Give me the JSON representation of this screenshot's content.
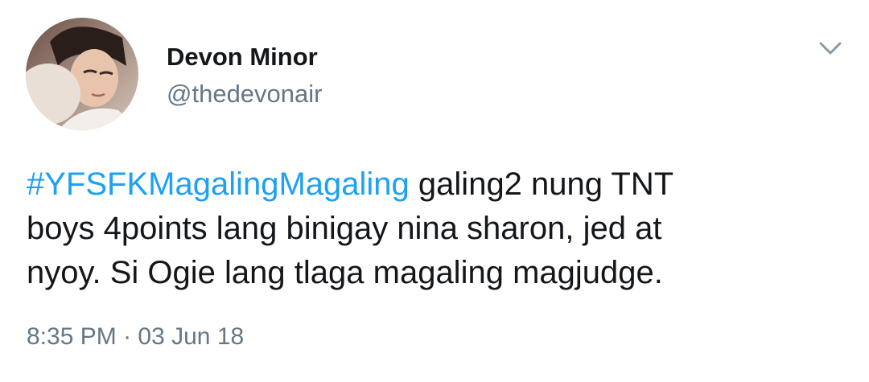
{
  "user": {
    "display_name": "Devon Minor",
    "handle": "@thedevonair"
  },
  "tweet": {
    "hashtag": "#YFSFKMagalingMagaling",
    "line1_rest": " galing2 nung TNT",
    "line2": "boys 4points lang binigay nina sharon, jed at",
    "line3": "nyoy. Si Ogie lang tlaga magaling magjudge.",
    "time": "8:35 PM",
    "separator": "·",
    "date": "03 Jun 18"
  },
  "icons": {
    "menu": "chevron-down-icon",
    "avatar": "user-avatar"
  },
  "colors": {
    "hashtag": "#1da1f2",
    "secondary_text": "#657786",
    "primary_text": "#14171a"
  }
}
